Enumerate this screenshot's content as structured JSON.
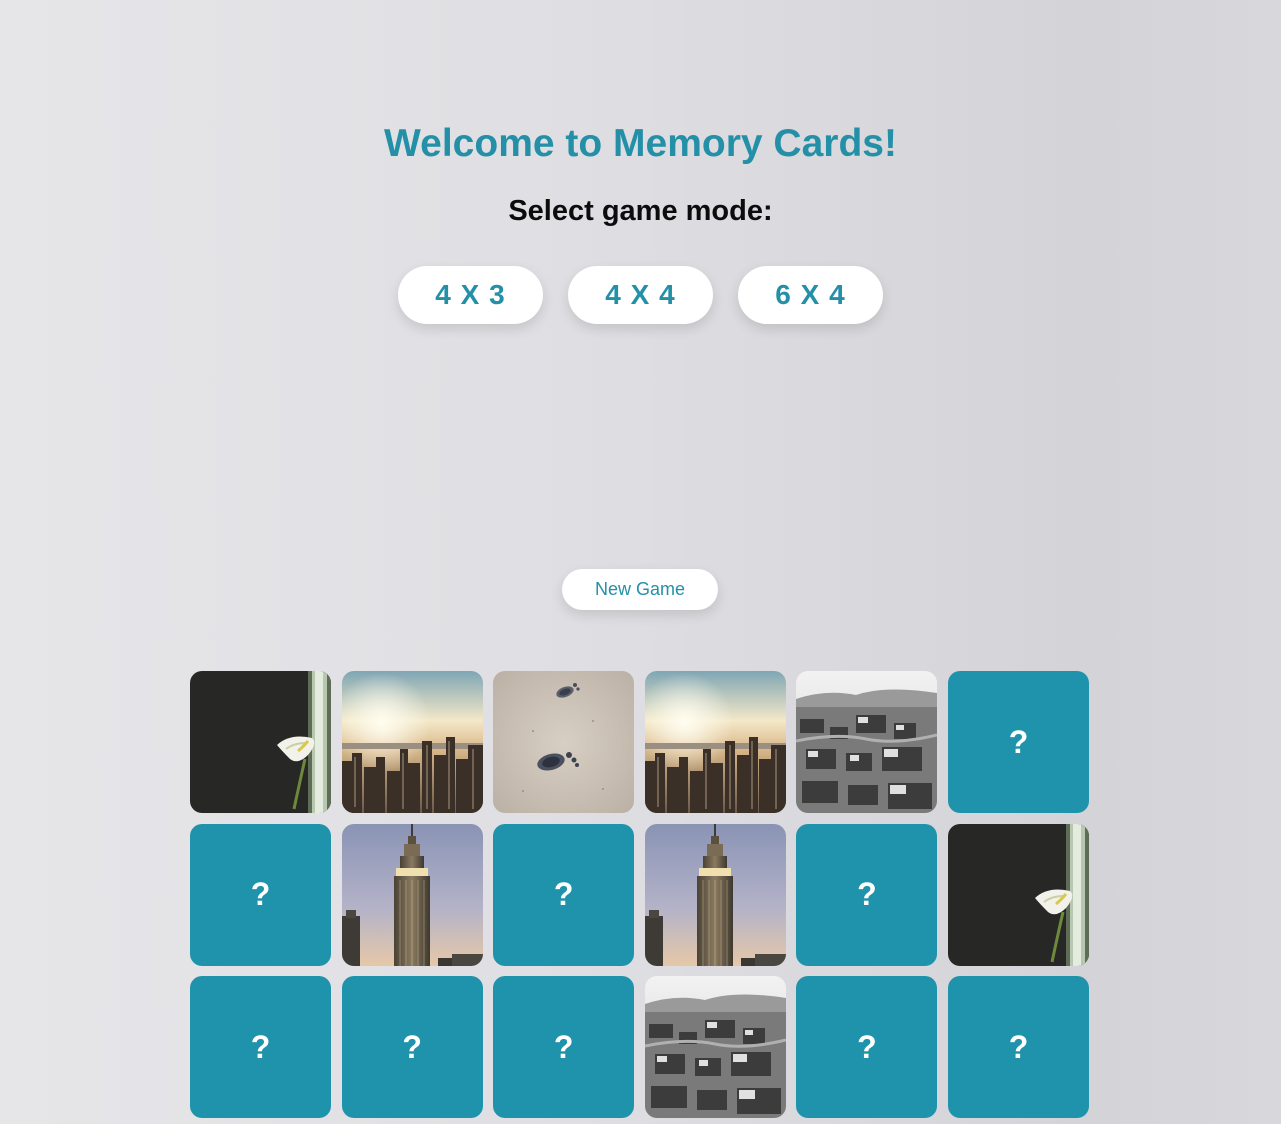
{
  "header": {
    "title": "Welcome to Memory Cards!",
    "subtitle": "Select game mode:"
  },
  "modes": [
    {
      "label": "4 X 3"
    },
    {
      "label": "4 X 4"
    },
    {
      "label": "6 X 4"
    }
  ],
  "controls": {
    "new_game_label": "New Game"
  },
  "board": {
    "hidden_symbol": "?",
    "cards": [
      {
        "state": "flipped",
        "image": "calla-lily"
      },
      {
        "state": "flipped",
        "image": "city-skyline-sunset"
      },
      {
        "state": "flipped",
        "image": "footprints-sand"
      },
      {
        "state": "flipped",
        "image": "city-skyline-sunset"
      },
      {
        "state": "flipped",
        "image": "bw-old-town"
      },
      {
        "state": "hidden"
      },
      {
        "state": "hidden"
      },
      {
        "state": "flipped",
        "image": "empire-state-building"
      },
      {
        "state": "hidden"
      },
      {
        "state": "flipped",
        "image": "empire-state-building"
      },
      {
        "state": "hidden"
      },
      {
        "state": "flipped",
        "image": "calla-lily"
      },
      {
        "state": "hidden"
      },
      {
        "state": "hidden"
      },
      {
        "state": "hidden"
      },
      {
        "state": "flipped",
        "image": "bw-old-town"
      },
      {
        "state": "hidden"
      },
      {
        "state": "hidden"
      }
    ]
  },
  "colors": {
    "accent": "#2490a8",
    "card_back": "#1f93ab",
    "button_bg": "#ffffff"
  }
}
